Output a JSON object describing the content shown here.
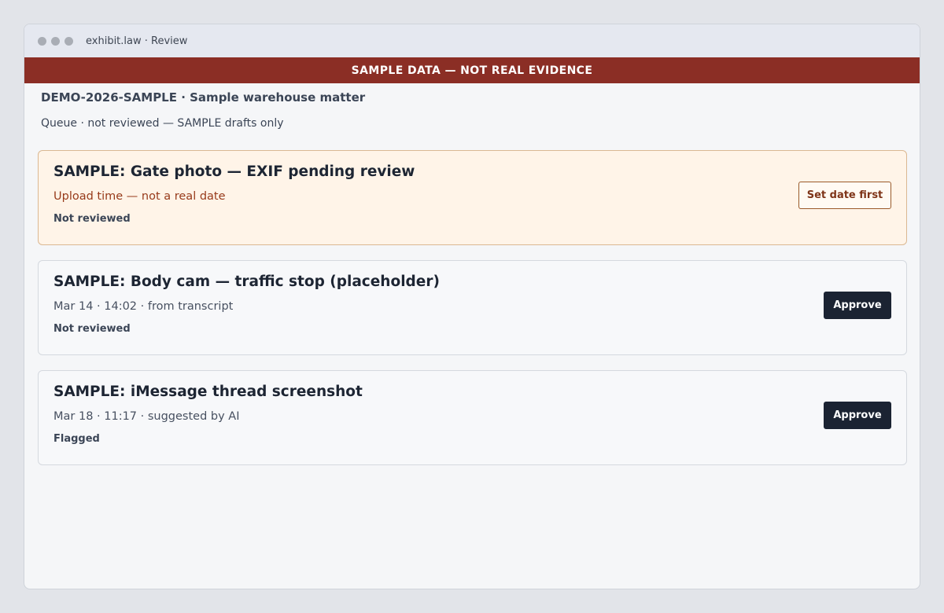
{
  "window": {
    "title": "exhibit.law · Review"
  },
  "banner": {
    "text": "SAMPLE DATA — NOT REAL EVIDENCE"
  },
  "matter": {
    "title": "DEMO-2026-SAMPLE · Sample warehouse matter",
    "queue_text": "Queue · not reviewed — SAMPLE drafts only"
  },
  "items": [
    {
      "title": "SAMPLE: Gate photo — EXIF pending review",
      "meta": "Upload time — not a real date",
      "status": "Not reviewed",
      "action_label": "Set date first"
    },
    {
      "title": "SAMPLE: Body cam — traffic stop (placeholder)",
      "meta": "Mar 14 · 14:02 · from transcript",
      "status": "Not reviewed",
      "action_label": "Approve"
    },
    {
      "title": "SAMPLE: iMessage thread screenshot",
      "meta": "Mar 18 · 11:17 · suggested by AI",
      "status": "Flagged",
      "action_label": "Approve"
    }
  ],
  "colors": {
    "banner_bg": "#8b2e25",
    "warning_card_bg": "#fff4e8",
    "primary_button_bg": "#1b2332"
  }
}
